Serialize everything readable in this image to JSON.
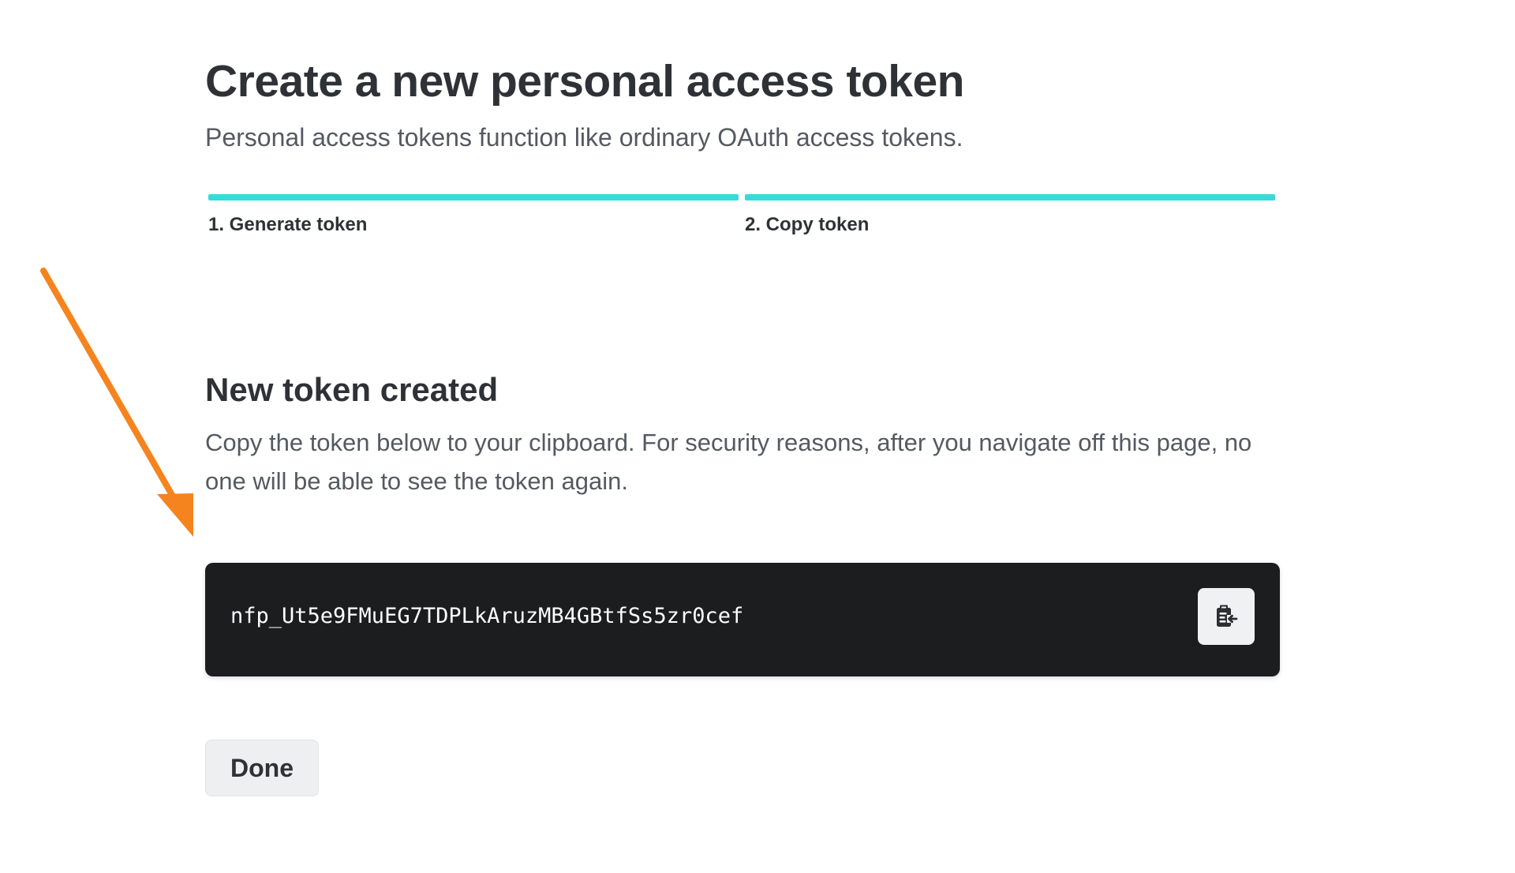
{
  "header": {
    "title": "Create a new personal access token",
    "subtitle": "Personal access tokens function like ordinary OAuth access tokens."
  },
  "steps": [
    {
      "label": "1. Generate token",
      "complete": true
    },
    {
      "label": "2. Copy token",
      "complete": true
    }
  ],
  "section": {
    "heading": "New token created",
    "description": "Copy the token below to your clipboard. For security reasons, after you navigate off this page, no one will be able to see the token again."
  },
  "token": {
    "value": "nfp_Ut5e9FMuEG7TDPLkAruzMB4GBtfSs5zr0cef",
    "copy_icon": "clipboard-copy-icon"
  },
  "actions": {
    "done_label": "Done"
  },
  "annotation": {
    "icon": "arrow",
    "color": "#f5841f"
  },
  "colors": {
    "step_complete": "#3ad9d9",
    "token_bg": "#1b1d1f",
    "text_primary": "#2e3236",
    "text_secondary": "#545a61"
  }
}
